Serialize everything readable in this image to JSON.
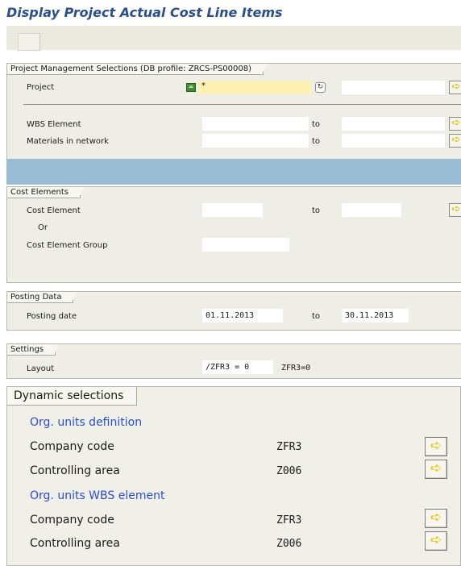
{
  "page": {
    "title": "Display Project Actual Cost Line Items"
  },
  "project_mgmt": {
    "group_title": "Project Management Selections (DB profile: ZRCS-PS00008)",
    "project_label": "Project",
    "project_value": "*",
    "wbs_label": "WBS Element",
    "materials_label": "Materials in network",
    "to_label": "to"
  },
  "cost_elements": {
    "group_title": "Cost Elements",
    "cost_element_label": "Cost Element",
    "or_label": "Or",
    "cost_element_group_label": "Cost Element Group",
    "to_label": "to"
  },
  "posting": {
    "group_title": "Posting Data",
    "posting_date_label": "Posting date",
    "from": "01.11.2013",
    "to_label": "to",
    "to": "30.11.2013"
  },
  "settings": {
    "group_title": "Settings",
    "layout_label": "Layout",
    "layout_value": "/ZFR3 = 0",
    "layout_desc": "ZFR3=0"
  },
  "dynamic": {
    "tab_title": "Dynamic selections",
    "sections": [
      {
        "heading": "Org. units definition",
        "rows": [
          {
            "label": "Company code",
            "value": "ZFR3"
          },
          {
            "label": "Controlling area",
            "value": "Z006"
          }
        ]
      },
      {
        "heading": "Org. units WBS element",
        "rows": [
          {
            "label": "Company code",
            "value": "ZFR3"
          },
          {
            "label": "Controlling area",
            "value": "Z006"
          }
        ]
      }
    ]
  },
  "icons": {
    "multiple_selection": "arrow-right-icon",
    "selection_option": "select-option-icon",
    "matchcode": "matchcode-icon"
  },
  "colors": {
    "title": "#2a4f8f",
    "section_band": "#98bcd4",
    "required_field": "#fdf2b3",
    "dynamic_heading": "#2b4ecf"
  }
}
